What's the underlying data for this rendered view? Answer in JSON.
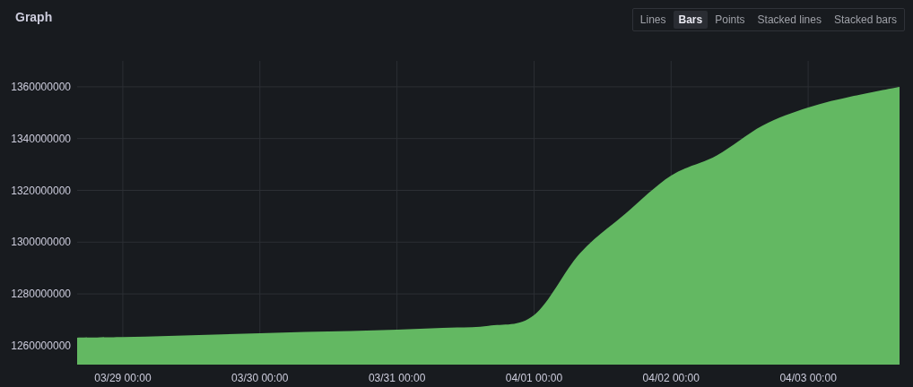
{
  "panel": {
    "title": "Graph"
  },
  "modes": [
    {
      "label": "Lines",
      "selected": false
    },
    {
      "label": "Bars",
      "selected": true
    },
    {
      "label": "Points",
      "selected": false
    },
    {
      "label": "Stacked lines",
      "selected": false
    },
    {
      "label": "Stacked bars",
      "selected": false
    }
  ],
  "chart_data": {
    "type": "area",
    "grid": true,
    "categories": [
      null,
      "03/29 00:00",
      null,
      null,
      "03/30 00:00",
      null,
      null,
      "03/31 00:00",
      null,
      null,
      "04/01 00:00",
      null,
      null,
      "04/02 00:00",
      null,
      null,
      "04/03 00:00",
      null,
      null
    ],
    "series": [
      {
        "color": "#63b862",
        "values": [
          1263100000,
          1263300000,
          1263800000,
          1264300000,
          1264800000,
          1265300000,
          1265700000,
          1266200000,
          1266900000,
          1267700000,
          1271800000,
          1295600000,
          1311000000,
          1325700000,
          1333500000,
          1345000000,
          1352000000,
          1356500000,
          1360000000
        ]
      }
    ],
    "ylim": [
      1252700000,
      1370000000
    ],
    "yticks": [
      1260000000,
      1280000000,
      1300000000,
      1320000000,
      1340000000,
      1360000000
    ]
  }
}
